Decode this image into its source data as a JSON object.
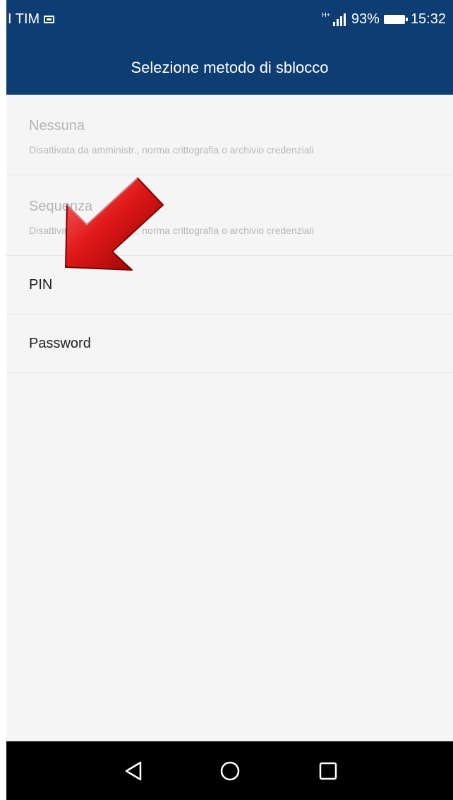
{
  "status_bar": {
    "carrier": "I TIM",
    "network_type": "H+",
    "battery_percent": "93%",
    "battery_level": 0.93,
    "time": "15:32",
    "icons": [
      "message-icon",
      "signal-icon",
      "battery-icon"
    ]
  },
  "app_bar": {
    "title": "Selezione metodo di sblocco",
    "background_color": "#0e3d73"
  },
  "unlock_methods": [
    {
      "label": "Nessuna",
      "summary": "Disattivata da amministr., norma crittografia o archivio credenziali",
      "enabled": false
    },
    {
      "label": "Sequenza",
      "summary": "Disattivata da amministr., norma crittografia o archivio credenziali",
      "enabled": false
    },
    {
      "label": "PIN",
      "enabled": true
    },
    {
      "label": "Password",
      "enabled": true
    }
  ],
  "annotation": {
    "type": "red-arrow-icon",
    "color": "#d01010",
    "points_to": "PIN"
  },
  "nav_bar": {
    "buttons": [
      "back-icon",
      "home-icon",
      "recents-icon"
    ]
  }
}
